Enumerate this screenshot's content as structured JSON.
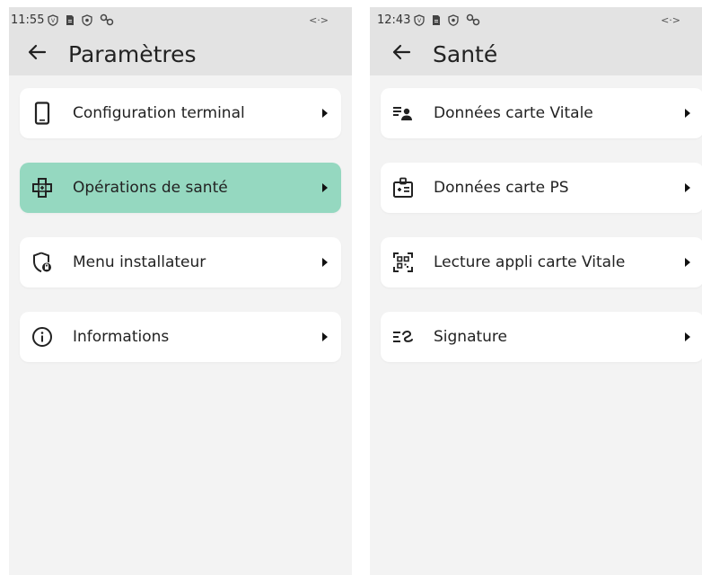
{
  "left_screen": {
    "status": {
      "time": "11:55",
      "icons": [
        "shield-badge-icon",
        "sim-card-icon",
        "vpn-shield-icon",
        "link-icon"
      ],
      "right_icon": "code-brackets-icon",
      "right_text": "<·>"
    },
    "appbar": {
      "title": "Paramètres",
      "back_icon": "arrow-left-icon"
    },
    "items": [
      {
        "label": "Configuration terminal",
        "icon": "smartphone-icon",
        "active": false
      },
      {
        "label": "Opérations de santé",
        "icon": "medical-cross-icon",
        "active": true
      },
      {
        "label": "Menu installateur",
        "icon": "admin-shield-icon",
        "active": false
      },
      {
        "label": "Informations",
        "icon": "info-icon",
        "active": false
      }
    ]
  },
  "right_screen": {
    "status": {
      "time": "12:43",
      "icons": [
        "shield-badge-icon",
        "sim-card-icon",
        "vpn-shield-icon",
        "link-icon"
      ],
      "right_icon": "code-brackets-icon",
      "right_text": "<·>"
    },
    "appbar": {
      "title": "Santé",
      "back_icon": "arrow-left-icon"
    },
    "items": [
      {
        "label": "Données carte Vitale",
        "icon": "id-list-icon",
        "active": false
      },
      {
        "label": "Données carte PS",
        "icon": "medical-badge-icon",
        "active": false
      },
      {
        "label": "Lecture appli carte Vitale",
        "icon": "qr-scan-icon",
        "active": false
      },
      {
        "label": "Signature",
        "icon": "signature-icon",
        "active": false
      }
    ]
  },
  "colors": {
    "accent": "#95d8c0",
    "bar": "#e3e3e3",
    "background": "#f3f3f3",
    "card": "#ffffff"
  }
}
